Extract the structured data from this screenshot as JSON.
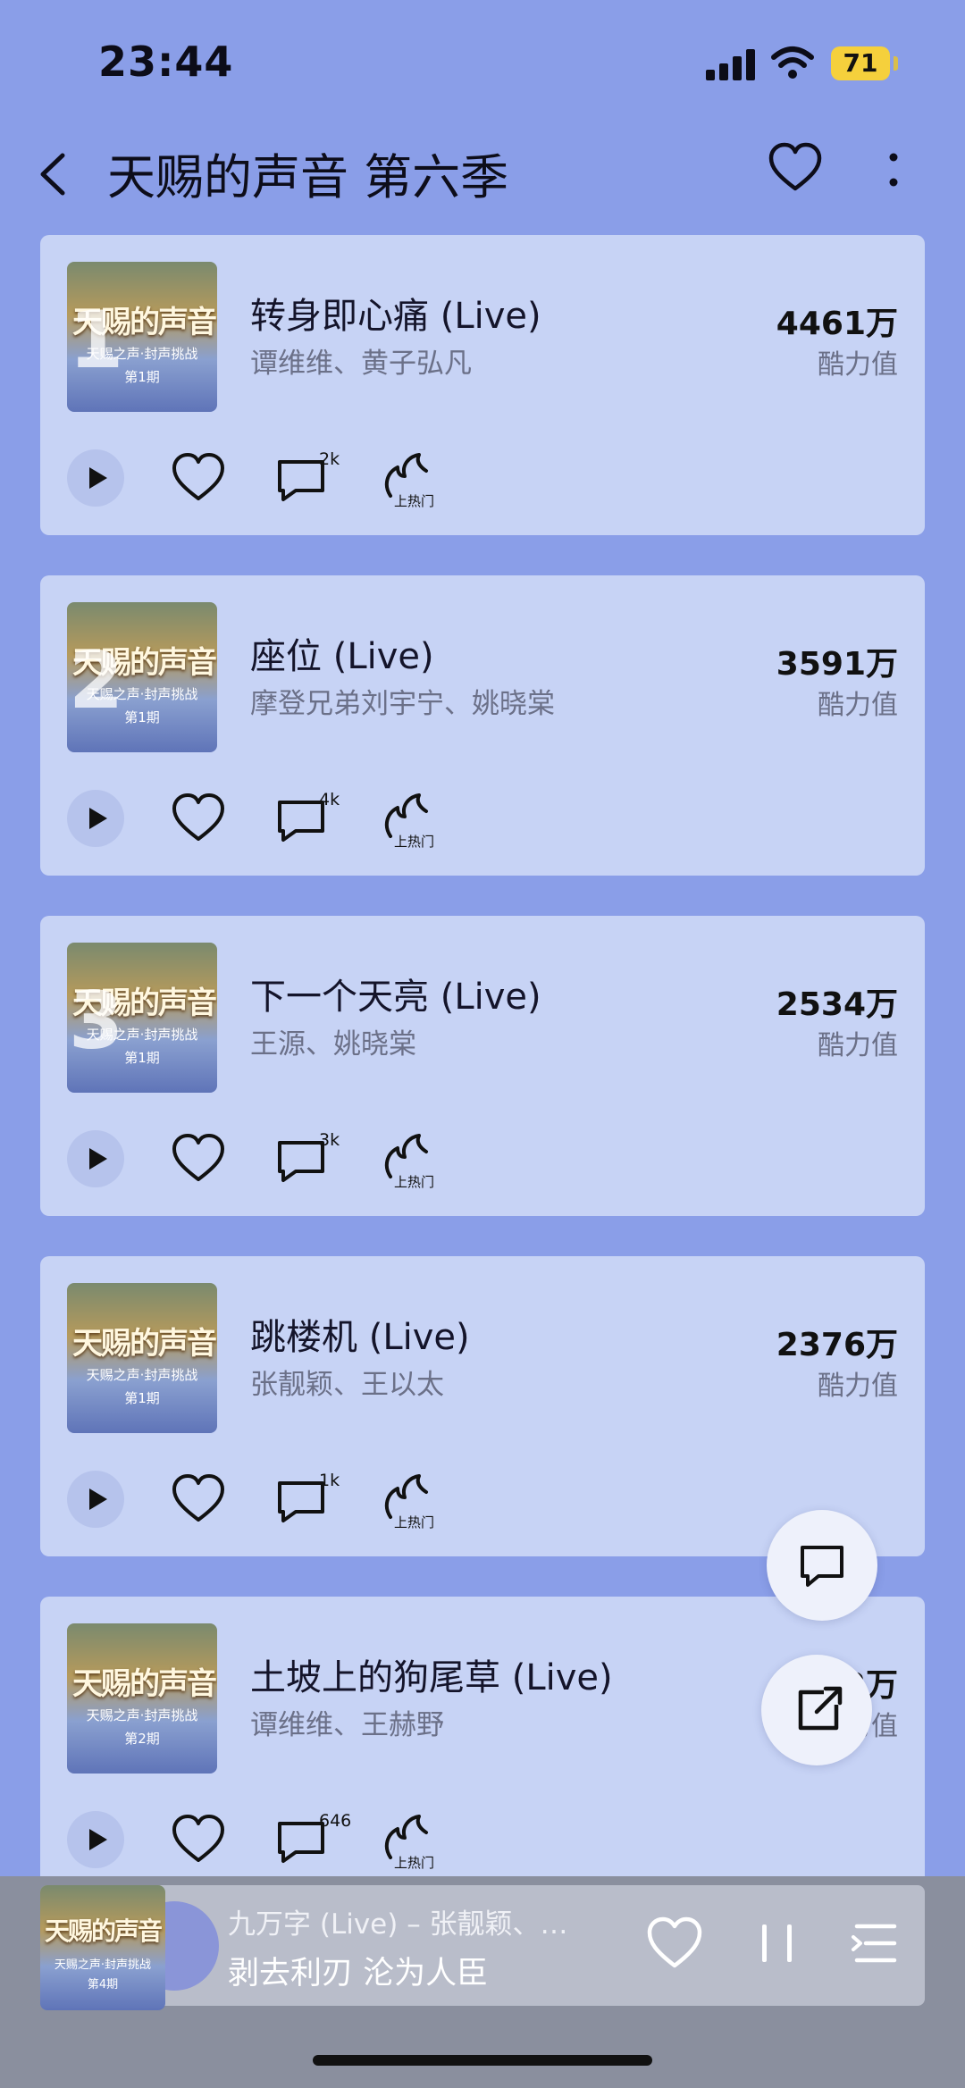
{
  "status_bar": {
    "time": "23:44",
    "battery": "71"
  },
  "header": {
    "title": "天赐的声音 第六季"
  },
  "cover": {
    "title": "天赐的声音",
    "subtitle": "天赐之声·封声挑战"
  },
  "score_label": "酷力值",
  "hot_label": "上热门",
  "songs": [
    {
      "rank": "1",
      "title": "转身即心痛 (Live)",
      "artist": "谭维维、黄子弘凡",
      "score": "4461万",
      "comments": "2k",
      "episode": "第1期"
    },
    {
      "rank": "2",
      "title": "座位 (Live)",
      "artist": "摩登兄弟刘宇宁、姚晓棠",
      "score": "3591万",
      "comments": "4k",
      "episode": "第1期"
    },
    {
      "rank": "3",
      "title": "下一个天亮 (Live)",
      "artist": "王源、姚晓棠",
      "score": "2534万",
      "comments": "3k",
      "episode": "第1期"
    },
    {
      "rank": "",
      "title": "跳楼机 (Live)",
      "artist": "张靓颖、王以太",
      "score": "2376万",
      "comments": "1k",
      "episode": "第1期"
    },
    {
      "rank": "",
      "title": "土坡上的狗尾草 (Live)",
      "artist": "谭维维、王赫野",
      "score": "1732万",
      "comments": "646",
      "episode": "第2期"
    }
  ],
  "player": {
    "song": "九万字 (Live) – 张靓颖、…",
    "lyric": "剥去利刃 沦为人臣",
    "episode": "第4期"
  },
  "icons": {
    "back": "chevron-left-icon",
    "favorite": "heart-icon",
    "more": "more-vertical-icon",
    "play": "play-icon",
    "like": "heart-icon",
    "comment": "comment-icon",
    "hot": "flame-icon",
    "share": "share-icon",
    "pause": "pause-icon",
    "playlist": "playlist-icon"
  },
  "colors": {
    "background": "#8a9ee8",
    "card": "#c7d3f5",
    "battery": "#f5d03c"
  }
}
